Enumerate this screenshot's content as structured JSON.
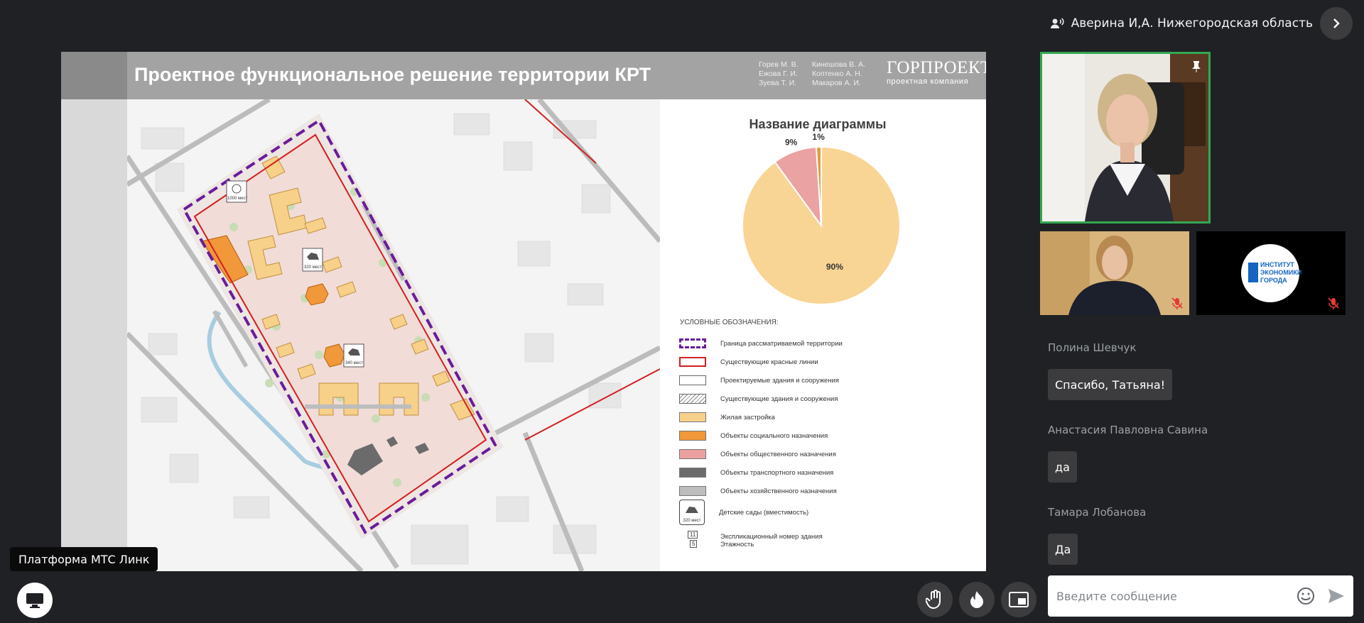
{
  "header": {
    "active_speaker": "Аверина И,А. Нижегородская область"
  },
  "slide": {
    "title": "Проектное функциональное решение территории КРТ",
    "authors_col1": [
      "Горев М. В.",
      "Ежова Г. И.",
      "Зуева Т. И."
    ],
    "authors_col2": [
      "Кинешова В. А.",
      "Коптенко А. Н.",
      "Макаров А. И."
    ],
    "brand_name": "ГОРПРОЕКТ",
    "brand_sub": "проектная компания",
    "map_labels": {
      "school_capacity": "1000 мест",
      "kinder1_capacity": "320 мест",
      "kinder2_capacity": "340 мест"
    },
    "legend_title": "УСЛОВНЫЕ ОБОЗНАЧЕНИЯ:",
    "legend": [
      {
        "label": "Граница рассматриваемой территории",
        "swatch": "dashed-purple"
      },
      {
        "label": "Существующие красные линии",
        "swatch": "red-outline"
      },
      {
        "label": "Проектируемые здания и сооружения",
        "swatch": "gray-outline"
      },
      {
        "label": "Существующие здания и сооружения",
        "swatch": "hatched"
      },
      {
        "label": "Жилая застройка",
        "swatch": "#f7d08a"
      },
      {
        "label": "Объекты социального назначения",
        "swatch": "#f0983a"
      },
      {
        "label": "Объекты общественного назначения",
        "swatch": "#eba0a0"
      },
      {
        "label": "Объекты транспортного назначения",
        "swatch": "#6b6b6b"
      },
      {
        "label": "Объекты хозяйственного назначения",
        "swatch": "#bdbdbd"
      },
      {
        "label": "Детские сады (вместимость)",
        "swatch": "kinder-icon",
        "icon_text": "320 мест"
      },
      {
        "label": "Экспликационный номер здания",
        "label2": "Этажность",
        "swatch": "number-icon",
        "icon_num": "11",
        "icon_floors": "5"
      }
    ]
  },
  "chart_data": {
    "type": "pie",
    "title": "Название диаграммы",
    "slices": [
      {
        "value": 90,
        "label": "90%",
        "color": "#f8d595"
      },
      {
        "value": 9,
        "label": "9%",
        "color": "#eaa2a2"
      },
      {
        "value": 1,
        "label": "1%",
        "color": "#e39a3f"
      }
    ]
  },
  "participants": {
    "tile2_muted": true,
    "tile3_logo_lines": [
      "ИНСТИТУТ",
      "ЭКОНОМИКИ",
      "ГОРОДА"
    ],
    "tile3_muted": true
  },
  "chat": {
    "messages": [
      {
        "author": "Полина Шевчук",
        "text": "Спасибо, Татьяна!"
      },
      {
        "author": "Анастасия Павловна Савина",
        "text": "да"
      },
      {
        "author": "Тамара Лобанова",
        "text": "Да"
      }
    ],
    "input_placeholder": "Введите сообщение"
  },
  "bottom": {
    "platform_tooltip": "Платформа МТС Линк"
  },
  "colors": {
    "background": "#202124",
    "speaker_border": "#34a853",
    "muted": "#e53935"
  }
}
